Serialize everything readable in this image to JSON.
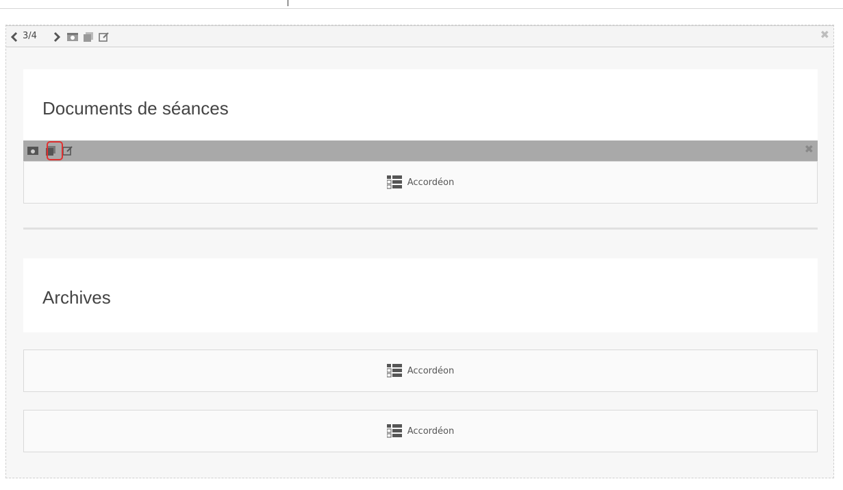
{
  "pager": {
    "counter": "3/4"
  },
  "sections": [
    {
      "title": "Documents de séances"
    },
    {
      "title": "Archives"
    }
  ],
  "widgets": [
    {
      "label": "Accordéon"
    },
    {
      "label": "Accordéon"
    },
    {
      "label": "Accordéon"
    }
  ],
  "icons": {
    "prev": "chevron-left-icon",
    "next": "chevron-right-icon",
    "image": "image-icon",
    "copy": "copy-icon",
    "edit": "edit-icon",
    "close": "close-icon",
    "accordion": "accordion-icon"
  },
  "colors": {
    "highlight": "#e03030",
    "inner_toolbar": "#a9a9a9"
  }
}
